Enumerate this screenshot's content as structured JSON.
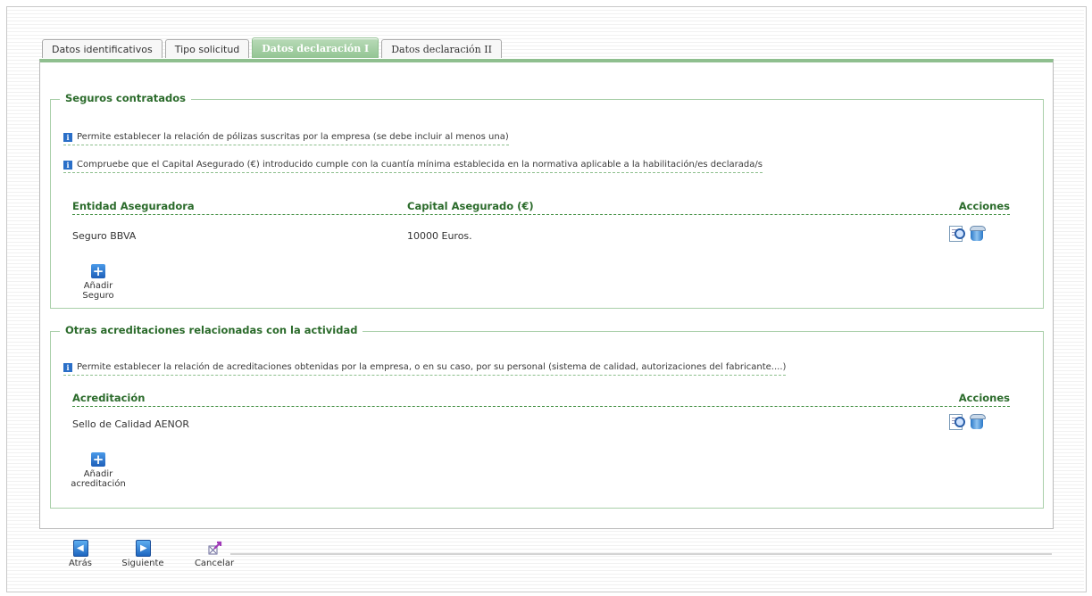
{
  "tabs": [
    {
      "label": "Datos identificativos",
      "active": false
    },
    {
      "label": "Tipo solicitud",
      "active": false
    },
    {
      "label": "Datos declaración I",
      "active": true
    },
    {
      "label": "Datos declaración II",
      "active": false
    }
  ],
  "seguros": {
    "legend": "Seguros contratados",
    "info1": "Permite establecer la relación de pólizas suscritas por la empresa (se debe incluir al menos una)",
    "info2": "Compruebe que el Capital Asegurado (€) introducido cumple con la cuantía mínima establecida en la normativa aplicable a la habilitación/es declarada/s",
    "columns": {
      "entidad": "Entidad Aseguradora",
      "capital": "Capital Asegurado (€)",
      "acciones": "Acciones"
    },
    "rows": [
      {
        "entidad": "Seguro BBVA",
        "capital": "10000 Euros."
      }
    ],
    "add_label": "Añadir Seguro"
  },
  "acreditaciones": {
    "legend": "Otras acreditaciones relacionadas con la actividad",
    "info1": "Permite establecer la relación de acreditaciones obtenidas por la empresa, o en su caso, por su personal (sistema de calidad, autorizaciones del fabricante....)",
    "columns": {
      "acreditacion": "Acreditación",
      "acciones": "Acciones"
    },
    "rows": [
      {
        "acreditacion": "Sello de Calidad AENOR"
      }
    ],
    "add_label_1": "Añadir",
    "add_label_2": "acreditación"
  },
  "nav": {
    "back": "Atrás",
    "next": "Siguiente",
    "cancel": "Cancelar"
  },
  "colors": {
    "accent_green": "#2b6b2b",
    "tab_active": "#93c593",
    "info_icon": "#2a6fc8"
  },
  "icons": [
    "info-icon",
    "view-icon",
    "delete-icon",
    "add-icon",
    "back-icon",
    "next-icon",
    "cancel-icon"
  ]
}
